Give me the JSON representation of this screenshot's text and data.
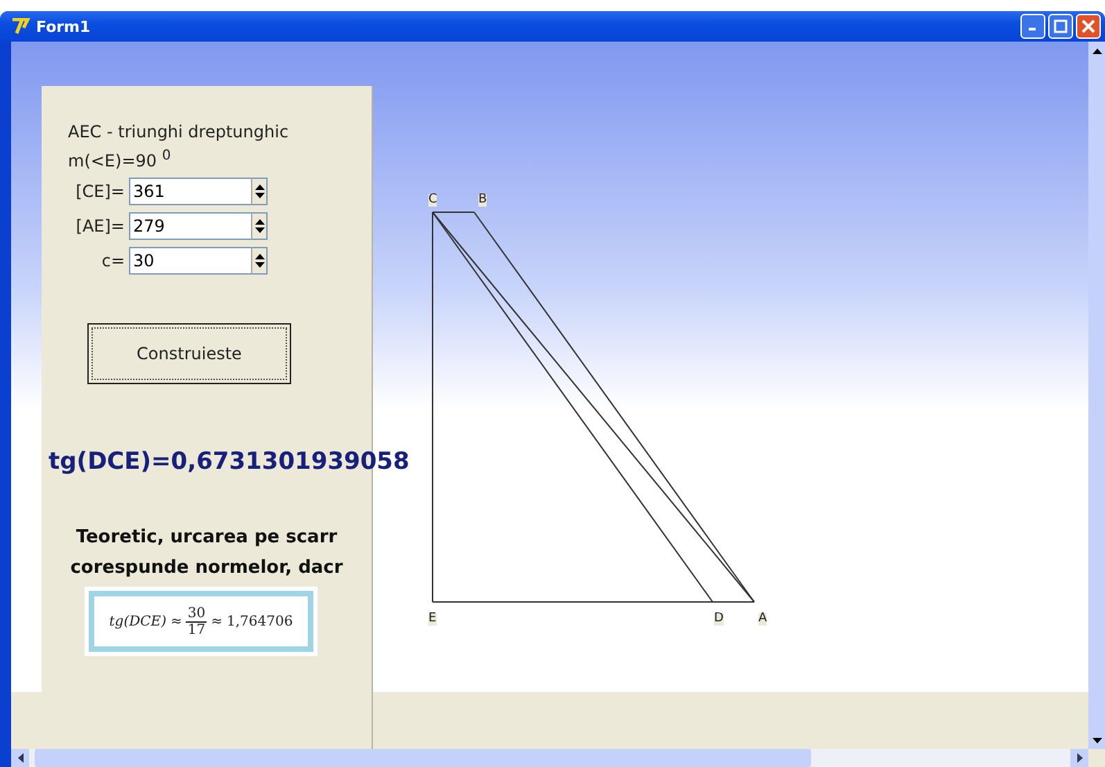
{
  "window": {
    "title": "Form1"
  },
  "panel": {
    "heading": "AEC - triunghi dreptunghic",
    "angle": "m(<E)=90 $^{0}$",
    "fields": [
      {
        "label": "[CE]=",
        "value": "361"
      },
      {
        "label": "[AE]=",
        "value": "279"
      },
      {
        "label": "c=",
        "value": "30"
      }
    ],
    "button": "Construieste",
    "result": "tg(DCE)=0,6731301939058",
    "note": [
      "Teoretic, urcarea pe scarr",
      "corespunde normelor, dacr"
    ],
    "formula": {
      "lhs": "tg(DCE)",
      "approx1": "≈",
      "numerator": "30",
      "denominator": "17",
      "approx2": "≈",
      "value": "1,764706"
    }
  },
  "diagram": {
    "points": [
      {
        "label": "C"
      },
      {
        "label": "B"
      },
      {
        "label": "E"
      },
      {
        "label": "D"
      },
      {
        "label": "A"
      }
    ]
  }
}
